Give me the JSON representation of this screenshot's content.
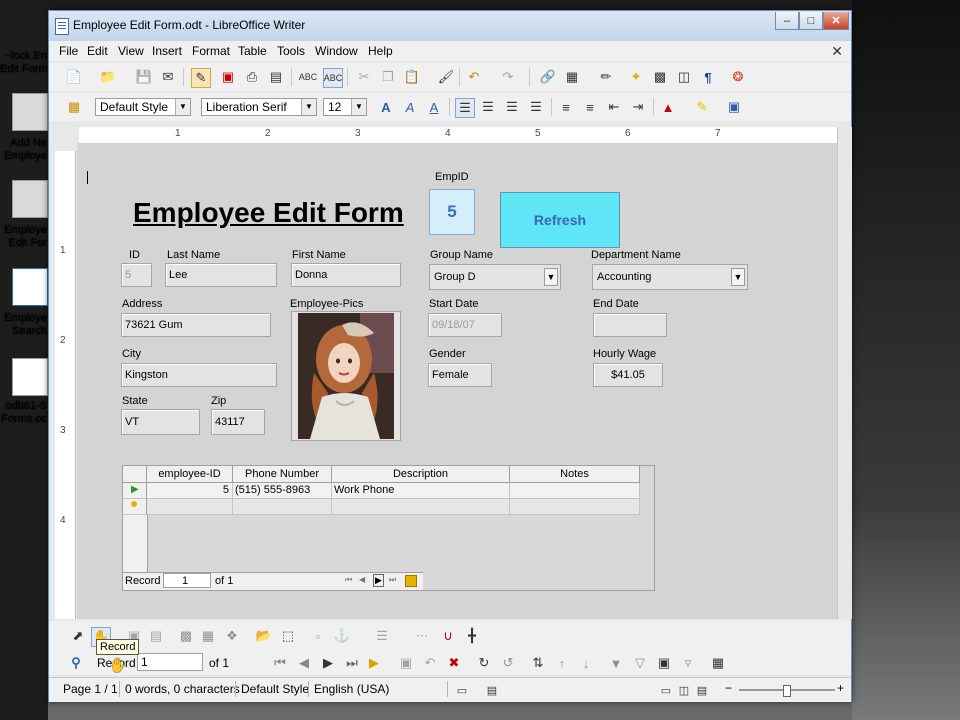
{
  "desktop": {
    "icons": [
      {
        "label1": "~lock.En",
        "label2": "Edit Form"
      },
      {
        "label1": "Add Ne",
        "label2": "Employe"
      },
      {
        "label1": "Employe",
        "label2": "Edit For"
      },
      {
        "label1": "Employe",
        "label2": "Search"
      },
      {
        "label1": "odb61-S",
        "label2": "Forms.oc"
      }
    ],
    "thumb_odb": "odb"
  },
  "window": {
    "title": "Employee Edit Form.odt - LibreOffice Writer",
    "minimize": "–",
    "maximize": "□",
    "close": "✕"
  },
  "menu": {
    "items": [
      "File",
      "Edit",
      "View",
      "Insert",
      "Format",
      "Table",
      "Tools",
      "Window",
      "Help"
    ],
    "doc_close": "✕"
  },
  "format_bar": {
    "style": "Default Style",
    "font": "Liberation Serif",
    "size": "12"
  },
  "ruler": {
    "numbers": [
      "1",
      "2",
      "3",
      "4",
      "5",
      "6",
      "7"
    ],
    "vnumbers": [
      "1",
      "2",
      "3",
      "4"
    ]
  },
  "form": {
    "title": "Employee Edit Form",
    "empid_label": "EmpID",
    "empid_value": "5",
    "refresh_label": "Refresh",
    "id_label": "ID",
    "id_value": "5",
    "last_name_label": "Last Name",
    "last_name_value": "Lee",
    "first_name_label": "First Name",
    "first_name_value": "Donna",
    "group_name_label": "Group Name",
    "group_name_value": "Group D",
    "department_label": "Department Name",
    "department_value": "Accounting",
    "address_label": "Address",
    "address_value": "73621 Gum",
    "pics_label": "Employee-Pics",
    "start_date_label": "Start Date",
    "start_date_value": "09/18/07",
    "end_date_label": "End Date",
    "end_date_value": "",
    "city_label": "City",
    "city_value": "Kingston",
    "gender_label": "Gender",
    "gender_value": "Female",
    "wage_label": "Hourly Wage",
    "wage_value": "$41.05",
    "state_label": "State",
    "state_value": "VT",
    "zip_label": "Zip",
    "zip_value": "43117"
  },
  "grid": {
    "columns": [
      "employee-ID",
      "Phone Number",
      "Description",
      "Notes"
    ],
    "rows": [
      {
        "employee_id": "5",
        "phone": "(515) 555-8963",
        "description": "Work Phone",
        "notes": ""
      }
    ],
    "record_label": "Record",
    "record_value": "1",
    "of_label": "of 1"
  },
  "nav_toolbar": {
    "record_label": "Record",
    "record_value": "1",
    "of_label": "of 1"
  },
  "tooltip": "Record",
  "status": {
    "page": "Page 1 / 1",
    "words": "0 words, 0 characters",
    "style": "Default Style",
    "language": "English (USA)"
  },
  "colors": {
    "refresh_bg": "#5ee5f6",
    "empid_bg": "#d4eefa",
    "doc_bg": "#d4d4d4"
  }
}
